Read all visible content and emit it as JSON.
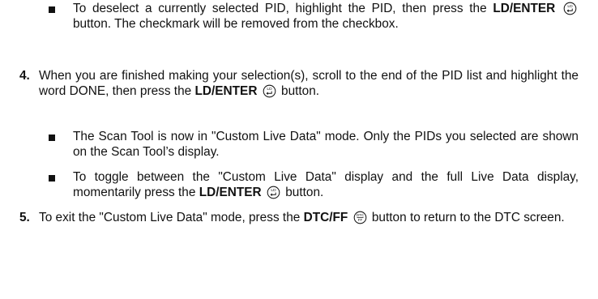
{
  "items": {
    "b1": {
      "a": "To deselect a currently selected PID, highlight the PID, then press the",
      "btn": "LD/ENTER",
      "b": "button. The checkmark will be removed from the checkbox."
    },
    "s4": {
      "num": "4.",
      "a": "When you are finished making your selection(s), scroll to the end of the PID list and highlight the word DONE, then press the",
      "btn": "LD/ENTER",
      "b": "button."
    },
    "b2": {
      "text": "The Scan Tool is now in \"Custom Live Data\" mode. Only the PIDs you selected are shown on the Scan Tool’s display."
    },
    "b3": {
      "a": "To toggle between the \"Custom Live Data\" display and the full Live Data display, momentarily press the",
      "btn": "LD/ENTER",
      "b": "button."
    },
    "s5": {
      "num": "5.",
      "a": "To exit the \"Custom Live Data\" mode, press the",
      "btn": "DTC/FF",
      "b": "button to return to the DTC screen."
    }
  },
  "icons": {
    "ld_enter": {
      "name": "ld-enter-icon",
      "label": "LD"
    },
    "dtc_ff": {
      "name": "dtc-ff-icon",
      "label_top": "DTC",
      "label_bottom": "FF"
    }
  }
}
